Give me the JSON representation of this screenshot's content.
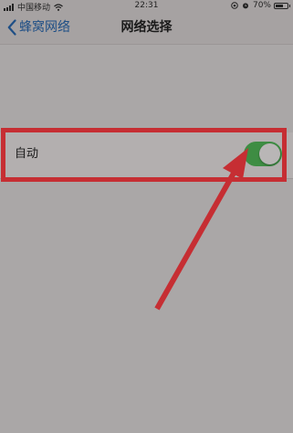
{
  "status_bar": {
    "carrier": "中国移动",
    "time": "22:31",
    "battery": "70%",
    "battery_level": 0.7
  },
  "nav": {
    "back_label": "蜂窝网络",
    "title": "网络选择"
  },
  "row": {
    "label": "自动",
    "toggle_state": "on"
  },
  "colors": {
    "toggle_on": "#3e8d43",
    "link": "#1f4f86",
    "annotation": "#c62e33"
  }
}
